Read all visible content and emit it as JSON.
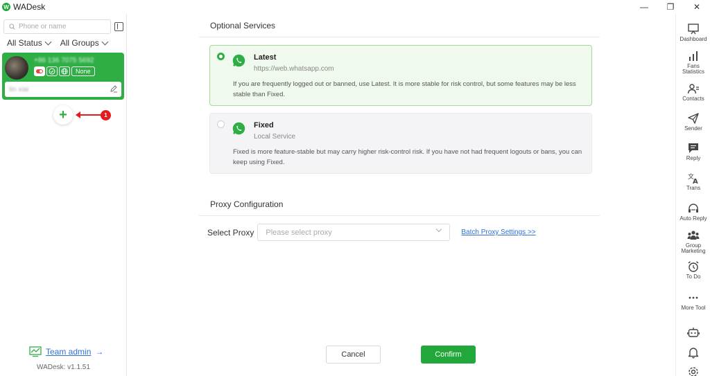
{
  "app": {
    "title": "WADesk",
    "logo_letter": "W"
  },
  "window_controls": {
    "minimize": "—",
    "restore": "❐",
    "close": "✕"
  },
  "sidebar": {
    "search_placeholder": "Phone or name",
    "filters": {
      "status": "All Status",
      "groups": "All Groups"
    },
    "account": {
      "phone": "+86 136 7075 5692",
      "group_badge": "None",
      "remark": "tin xiai"
    },
    "add_label": "+",
    "step_badge": "1",
    "team_admin": {
      "label": "Team admin",
      "arrow": "→"
    },
    "version": "WADesk: v1.1.51"
  },
  "main": {
    "optional_services_title": "Optional Services",
    "options": [
      {
        "name": "Latest",
        "subtitle": "https://web.whatsapp.com",
        "description": "If you are frequently logged out or banned, use Latest. It is more stable for risk control, but some features may be less stable than Fixed.",
        "selected": true
      },
      {
        "name": "Fixed",
        "subtitle": "Local Service",
        "description": "Fixed is more feature-stable but may carry higher risk-control risk. If you have not had frequent logouts or bans, you can keep using Fixed.",
        "selected": false
      }
    ],
    "proxy_title": "Proxy Configuration",
    "proxy": {
      "label": "Select Proxy",
      "placeholder": "Please select proxy",
      "batch_link": "Batch Proxy Settings >>"
    },
    "buttons": {
      "cancel": "Cancel",
      "confirm": "Confirm"
    }
  },
  "rail": {
    "items": [
      {
        "label": "Dashboard",
        "icon": "dashboard-icon"
      },
      {
        "label": "Fans Statistics",
        "icon": "bar-chart-icon"
      },
      {
        "label": "Contacts",
        "icon": "contacts-icon"
      },
      {
        "label": "Sender",
        "icon": "send-icon"
      },
      {
        "label": "Reply",
        "icon": "reply-icon"
      },
      {
        "label": "Trans",
        "icon": "translate-icon"
      },
      {
        "label": "Auto Reply",
        "icon": "headset-icon"
      },
      {
        "label": "Group Marketing",
        "icon": "group-icon"
      },
      {
        "label": "To Do",
        "icon": "alarm-icon"
      },
      {
        "label": "More Tool",
        "icon": "more-icon"
      }
    ],
    "bottom_icons": [
      "robot-icon",
      "bell-icon",
      "settings-icon"
    ]
  },
  "colors": {
    "brand_green": "#22a83a",
    "card_green": "#2fae46",
    "link_blue": "#2f6fd6",
    "alert_red": "#e11d1d"
  }
}
